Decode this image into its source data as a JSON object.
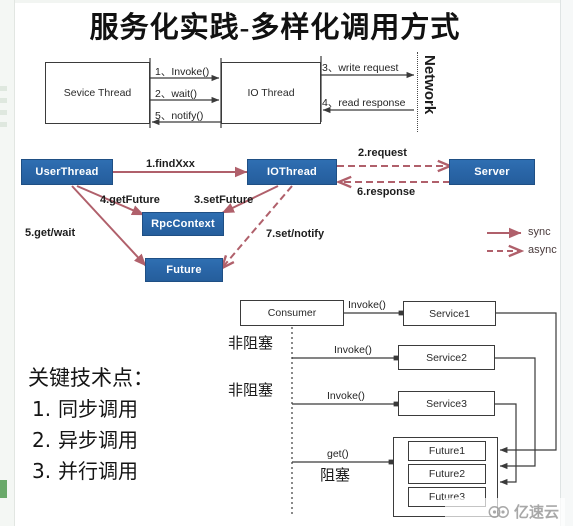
{
  "slide": {
    "title": "服务化实践-多样化调用方式"
  },
  "top_diagram": {
    "service_thread": "Sevice Thread",
    "io_thread": "IO Thread",
    "network": "Network",
    "arrows": [
      {
        "id": "invoke",
        "label": "1、Invoke()"
      },
      {
        "id": "wait",
        "label": "2、wait()"
      },
      {
        "id": "notify",
        "label": "5、notify()"
      },
      {
        "id": "write-request",
        "label": "3、write request"
      },
      {
        "id": "read-response",
        "label": "4、read response"
      }
    ]
  },
  "middle_diagram": {
    "nodes": {
      "user_thread": "UserThread",
      "io_thread": "IOThread",
      "server": "Server",
      "rpc_context": "RpcContext",
      "future": "Future"
    },
    "labels": {
      "find_xxx": "1.findXxx",
      "request": "2.request",
      "set_future": "3.setFuture",
      "get_future": "4.getFuture",
      "get_wait": "5.get/wait",
      "response": "6.response",
      "set_notify": "7.set/notify"
    },
    "legend": {
      "sync": "sync",
      "async": "async",
      "sync_color": "#b0606b",
      "async_color": "#b0606b"
    }
  },
  "sequence_diagram": {
    "consumer": "Consumer",
    "services": [
      "Service1",
      "Service2",
      "Service3"
    ],
    "invoke_labels": [
      "Invoke()",
      "Invoke()",
      "Invoke()"
    ],
    "nonblocking_labels": [
      "非阻塞",
      "非阻塞"
    ],
    "get_label": "get()",
    "blocking_label": "阻塞",
    "futures": [
      "Future1",
      "Future2",
      "Future3"
    ]
  },
  "key_points": {
    "heading": "关键技术点：",
    "items": [
      {
        "num": "1.",
        "text": "同步调用"
      },
      {
        "num": "2.",
        "text": "异步调用"
      },
      {
        "num": "3.",
        "text": "并行调用"
      }
    ]
  },
  "watermark": {
    "text": "亿速云",
    "logo": "cloud-icon"
  }
}
